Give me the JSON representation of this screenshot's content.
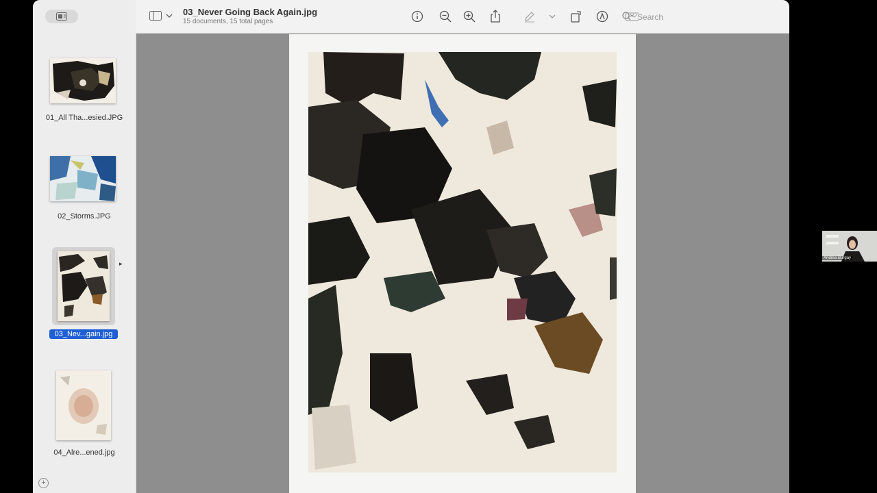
{
  "window": {
    "title": "03_Never Going Back Again.jpg",
    "subtitle": "15 documents, 15 total pages"
  },
  "sidebar": {
    "items": [
      {
        "label": "01_All Tha...esied.JPG",
        "selected": false
      },
      {
        "label": "02_Storms.JPG",
        "selected": false
      },
      {
        "label": "03_Nev...gain.jpg",
        "selected": true
      },
      {
        "label": "04_Alre...ened.jpg",
        "selected": false
      }
    ],
    "add_icon": "plus-circle-icon"
  },
  "toolbar": {
    "search_placeholder": "Search",
    "icons": [
      "sidebar-toggle-icon",
      "info-icon",
      "zoom-out-icon",
      "zoom-in-icon",
      "share-icon",
      "markup-pen-icon",
      "rotate-icon",
      "annotate-icon",
      "signature-icon",
      "search-icon"
    ]
  },
  "participant": {
    "name": "Andrea Burgay"
  },
  "colors": {
    "selection": "#1f5fd6",
    "canvas": "#8e8e8e",
    "sidebar": "#ededed"
  }
}
